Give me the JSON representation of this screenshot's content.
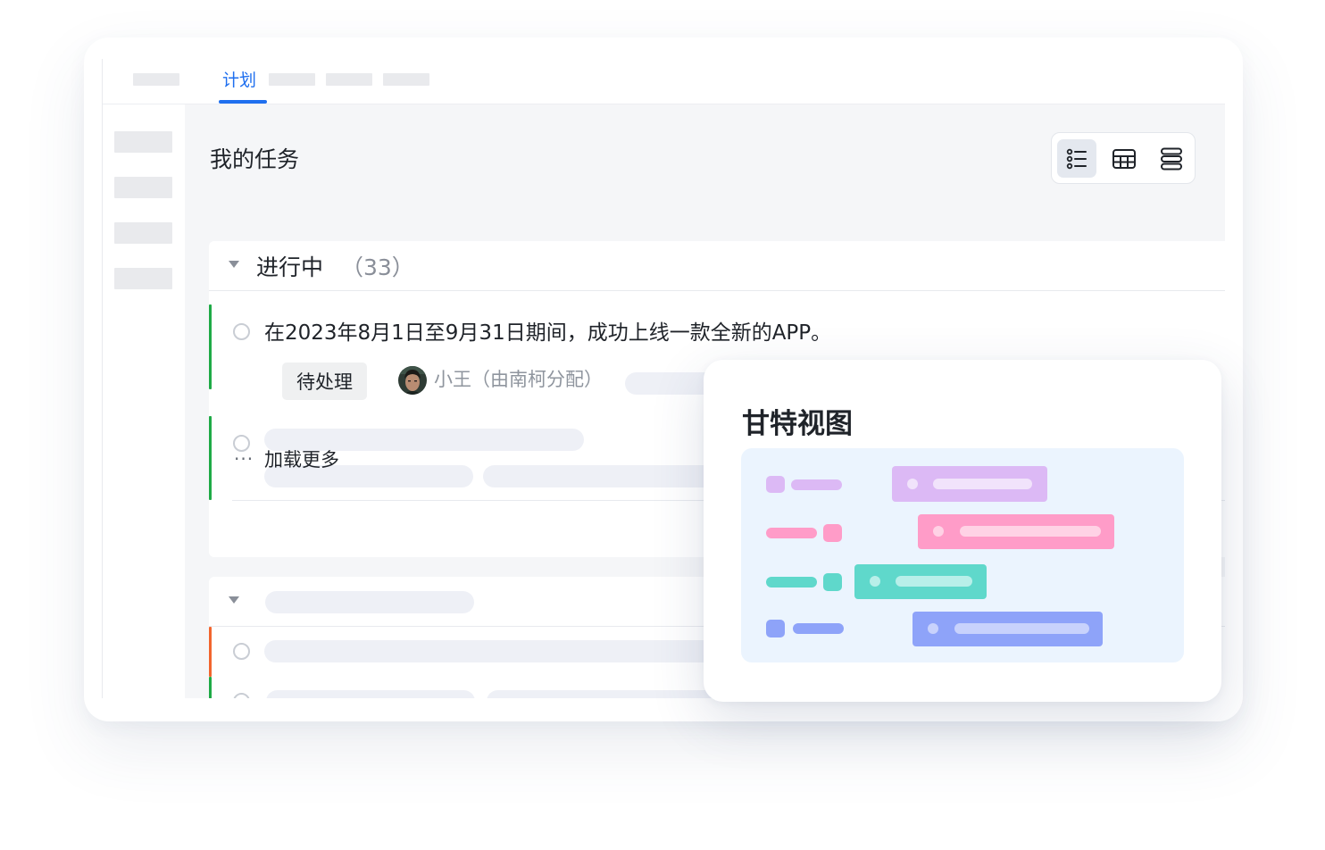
{
  "tabs": {
    "active_label": "计划"
  },
  "page": {
    "title": "我的任务"
  },
  "view_switcher": {
    "buttons": [
      {
        "icon": "list-view-icon",
        "active": true
      },
      {
        "icon": "table-view-icon",
        "active": false
      },
      {
        "icon": "gantt-view-icon",
        "active": false
      }
    ]
  },
  "group_in_progress": {
    "title": "进行中",
    "count": "（33）",
    "task": {
      "title": "在2023年8月1日至9月31日期间，成功上线一款全新的APP。",
      "status": "待处理",
      "assignee": "小王（由南柯分配）"
    },
    "load_more": "加载更多"
  },
  "gantt_card": {
    "title": "甘特视图",
    "colors": {
      "purple": "#dcb9f5",
      "pink": "#ff9cc8",
      "teal": "#5fd8cb",
      "blue": "#8ea3f9",
      "canvas": "#ebf4fe"
    }
  },
  "colors": {
    "accent": "#1f6fef",
    "in_progress_bar": "#1eaa46",
    "overdue_bar": "#f2652d"
  }
}
